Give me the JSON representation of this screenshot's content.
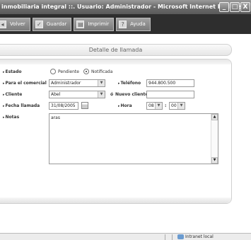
{
  "window": {
    "title": "inmobiliaria integral ::. Usuario: Administrador - Microsoft Internet Explorer",
    "controls": [
      "_",
      "□",
      "X"
    ]
  },
  "toolbar": {
    "back_label": "Volver",
    "save_label": "Guardar",
    "print_label": "Imprimir",
    "help_label": "Ayuda"
  },
  "section": {
    "title": "Detalle de llamada"
  },
  "form": {
    "estado_label": "Estado",
    "estado_options": [
      "Pendiente",
      "Notificada"
    ],
    "estado_selected": "Notificada",
    "comercial_label": "Para el comercial",
    "comercial_value": "Administrador",
    "telefono_label": "Teléfono",
    "telefono_value": "944.800.500",
    "cliente_label": "Cliente",
    "cliente_value": "Abel",
    "or_text": "ó",
    "nuevo_cliente_label": "Nuevo cliente",
    "nuevo_cliente_value": "",
    "fecha_label": "Fecha llamada",
    "fecha_value": "31/08/2005",
    "hora_label": "Hora",
    "hora_value": "08",
    "minuto_value": "00",
    "time_sep": ":",
    "notas_label": "Notas",
    "notas_value": "aras"
  },
  "statusbar": {
    "zone_label": "Intranet local"
  }
}
